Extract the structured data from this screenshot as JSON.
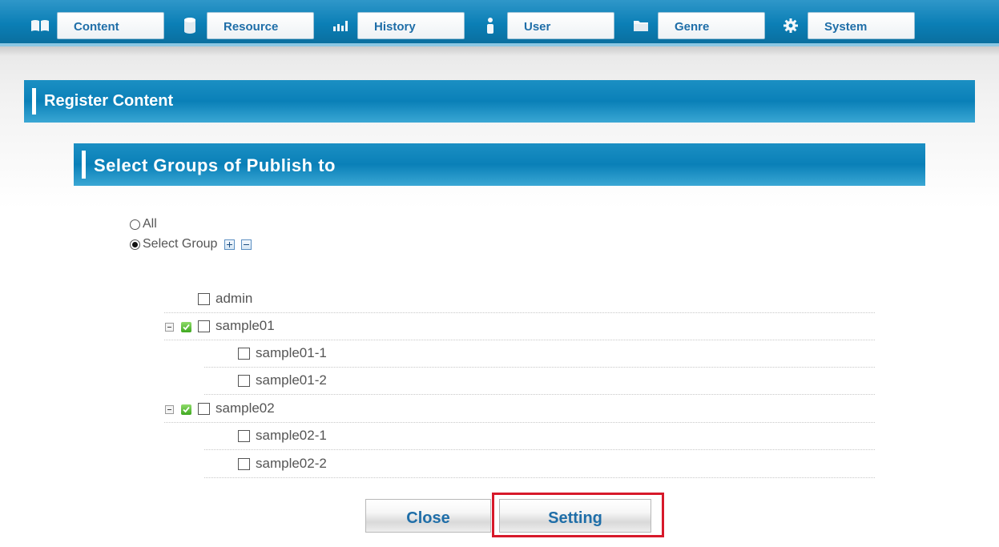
{
  "nav": [
    {
      "label": "Content",
      "icon": "book-icon"
    },
    {
      "label": "Resource",
      "icon": "database-icon"
    },
    {
      "label": "History",
      "icon": "bar-chart-icon"
    },
    {
      "label": "User",
      "icon": "person-icon"
    },
    {
      "label": "Genre",
      "icon": "folder-icon"
    },
    {
      "label": "System",
      "icon": "gear-icon"
    }
  ],
  "page_title": "Register Content",
  "section_title": "Select Groups of Publish to",
  "radios": {
    "all_label": "All",
    "select_group_label": "Select Group",
    "selected": "select_group"
  },
  "groups": [
    {
      "name": "admin",
      "level": 0,
      "expanded": null,
      "checked": false
    },
    {
      "name": "sample01",
      "level": 0,
      "expanded": true,
      "checked": false
    },
    {
      "name": "sample01-1",
      "level": 1,
      "expanded": null,
      "checked": false
    },
    {
      "name": "sample01-2",
      "level": 1,
      "expanded": null,
      "checked": false
    },
    {
      "name": "sample02",
      "level": 0,
      "expanded": true,
      "checked": false
    },
    {
      "name": "sample02-1",
      "level": 1,
      "expanded": null,
      "checked": false
    },
    {
      "name": "sample02-2",
      "level": 1,
      "expanded": null,
      "checked": false
    }
  ],
  "buttons": {
    "close_label": "Close",
    "setting_label": "Setting"
  },
  "colors": {
    "header_blue": "#0a80b8",
    "button_text": "#1f6ea8",
    "highlight_red": "#d7192a"
  }
}
